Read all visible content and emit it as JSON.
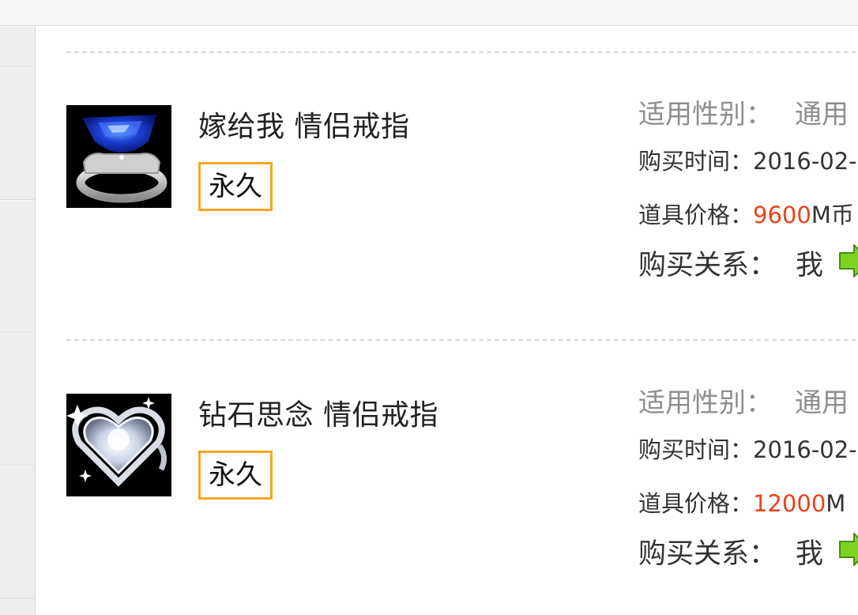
{
  "items": [
    {
      "name": "嫁给我 情侣戒指",
      "duration": "永久",
      "gender_label": "适用性别：",
      "gender_value": "通用",
      "time_label": "购买时间：",
      "time_value": "2016-02-",
      "price_label": "道具价格：",
      "price_value": "9600",
      "price_unit": "M币",
      "relation_label": "购买关系：",
      "relation_value": "我",
      "image_icon": "sapphire-ring-icon",
      "accent_color": "#1c3fd6"
    },
    {
      "name": "钻石思念 情侣戒指",
      "duration": "永久",
      "gender_label": "适用性别：",
      "gender_value": "通用",
      "time_label": "购买时间：",
      "time_value": "2016-02-",
      "price_label": "道具价格：",
      "price_value": "12000",
      "price_unit": "M",
      "relation_label": "购买关系：",
      "relation_value": "我",
      "image_icon": "diamond-heart-ring-icon",
      "accent_color": "#e8431b"
    }
  ],
  "colors": {
    "badge_border": "#f5a623",
    "price": "#e8431b",
    "arrow": "#7ed321"
  }
}
